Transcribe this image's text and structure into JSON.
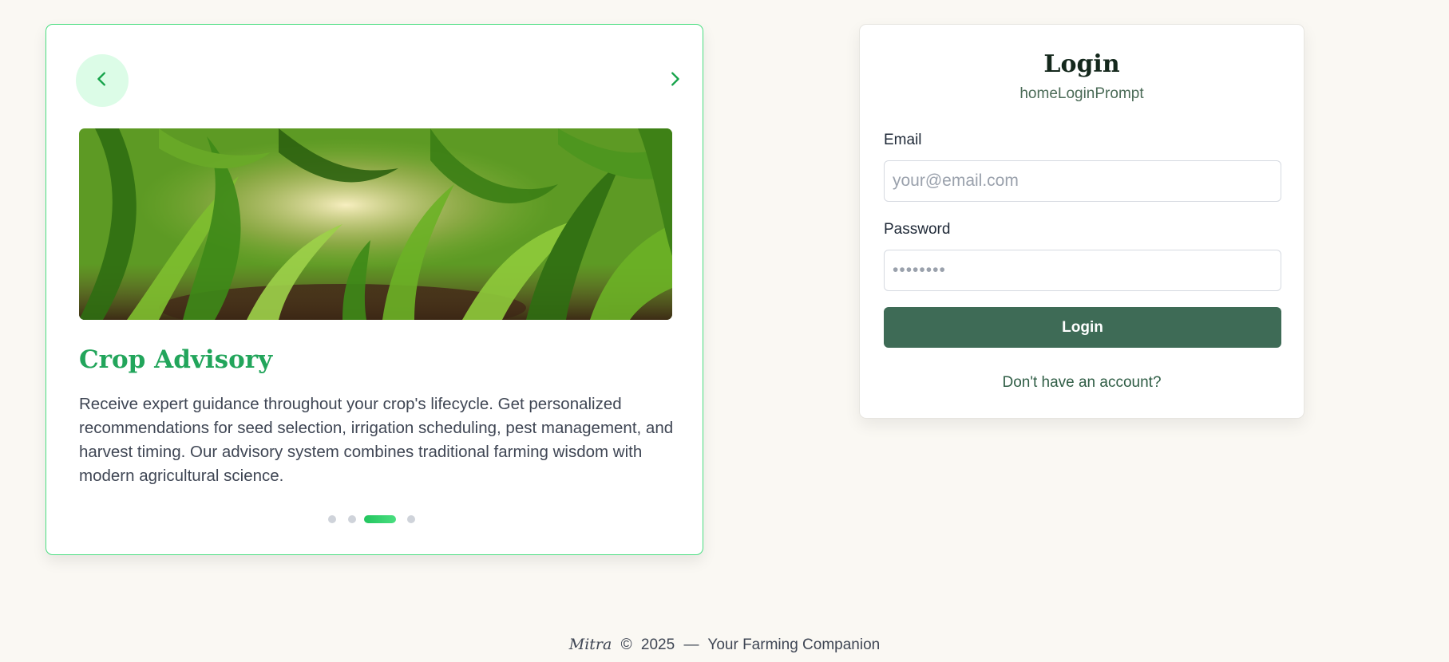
{
  "carousel": {
    "prev_icon": "chevron-left-icon",
    "next_icon": "chevron-right-icon",
    "slide": {
      "title": "Crop Advisory",
      "description": "Receive expert guidance throughout your crop's lifecycle. Get personalized recommendations for seed selection, irrigation scheduling, pest management, and harvest timing. Our advisory system combines traditional farming wisdom with modern agricultural science."
    },
    "dots_total": 4,
    "active_dot": 3,
    "colors": {
      "accent": "#22a55b",
      "border": "#4ade80",
      "prev_bg": "#dcfce7"
    }
  },
  "login": {
    "title": "Login",
    "prompt": "homeLoginPrompt",
    "email": {
      "label": "Email",
      "placeholder": "your@email.com",
      "value": ""
    },
    "password": {
      "label": "Password",
      "placeholder": "••••••••",
      "value": ""
    },
    "submit_label": "Login",
    "signup_link": "Don't have an account?",
    "colors": {
      "button": "#3e6b56"
    }
  },
  "footer": {
    "brand": "Mitra",
    "copyright": "©",
    "year": "2025",
    "dash": "—",
    "tagline": "Your Farming Companion"
  }
}
